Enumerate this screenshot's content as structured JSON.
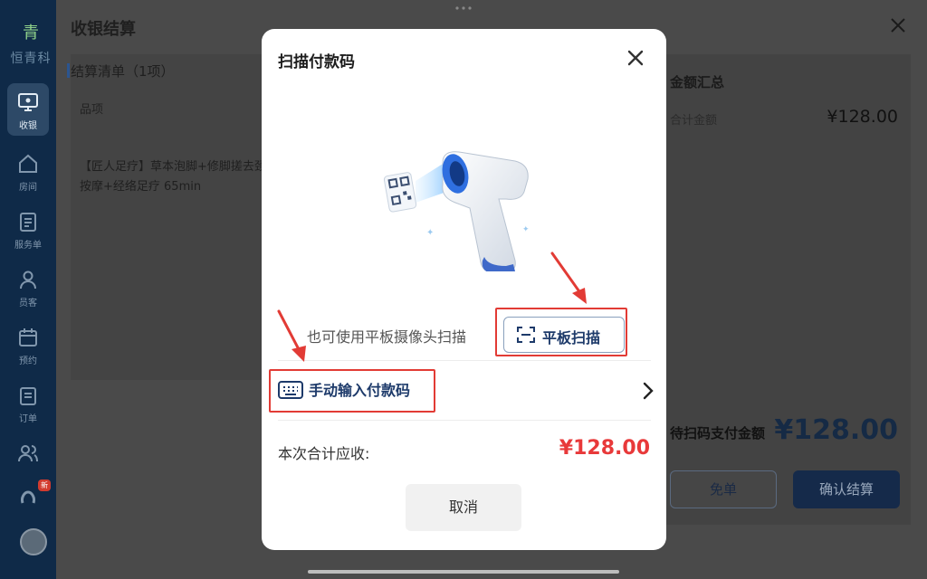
{
  "sidebar": {
    "brand_short": "青",
    "brand_name": "恒青科",
    "items": [
      {
        "label": "收银",
        "icon": "monitor-icon"
      },
      {
        "label": "房间",
        "icon": "home-icon"
      },
      {
        "label": "服务单",
        "icon": "clipboard-icon"
      },
      {
        "label": "员客",
        "icon": "user-icon"
      },
      {
        "label": "预约",
        "icon": "calendar-icon"
      },
      {
        "label": "订单",
        "icon": "order-icon"
      },
      {
        "label": "",
        "icon": "users-icon"
      }
    ],
    "badge": "新"
  },
  "page": {
    "title": "收银结算",
    "order_section": "结算清单（1项）",
    "column_item": "品项",
    "item_name": "【匠人足疗】草本泡脚+修脚搓去颈按摩+经络足疗 65min",
    "summary_title": "金额汇总",
    "subtotal_label": "合计金额",
    "subtotal_value": "¥128.00",
    "pay_label": "待扫码支付金额",
    "pay_value": "¥128.00",
    "free_label": "免单",
    "confirm_label": "确认结算"
  },
  "modal": {
    "title": "扫描付款码",
    "hint": "也可使用平板摄像头扫描",
    "tablet_scan_label": "平板扫描",
    "manual_label": "手动输入付款码",
    "total_label": "本次合计应收:",
    "total_value": "¥128.00",
    "cancel_label": "取消"
  },
  "colors": {
    "accent_blue": "#1d3a6a",
    "price_red": "#e8393a",
    "highlight_red": "#e23b35",
    "sidebar_bg": "#0f2a48"
  }
}
